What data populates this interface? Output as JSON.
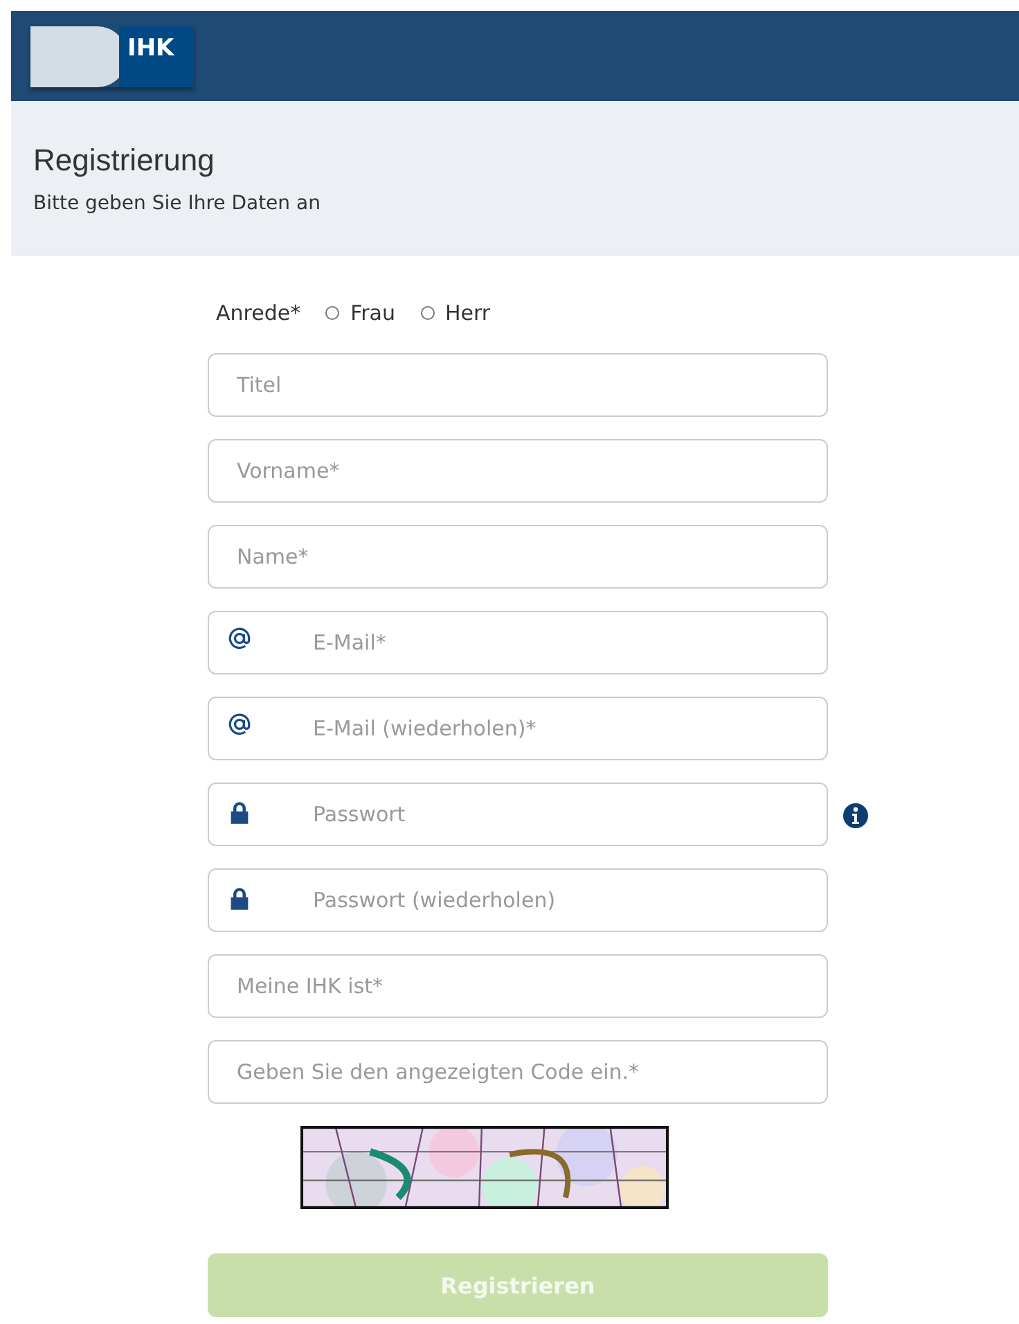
{
  "header": {
    "logo_text": "IHK"
  },
  "intro": {
    "title": "Registrierung",
    "subtitle": "Bitte geben Sie Ihre Daten an"
  },
  "salutation": {
    "label": "Anrede*",
    "options": [
      {
        "label": "Frau",
        "selected": false
      },
      {
        "label": "Herr",
        "selected": false
      }
    ]
  },
  "fields": [
    {
      "kind": "text",
      "placeholder": "Titel"
    },
    {
      "kind": "text",
      "placeholder": "Vorname*"
    },
    {
      "kind": "text",
      "placeholder": "Name*"
    },
    {
      "kind": "email",
      "placeholder": "E-Mail*"
    },
    {
      "kind": "email",
      "placeholder": "E-Mail (wiederholen)*"
    },
    {
      "kind": "password",
      "placeholder": "Passwort",
      "info": true
    },
    {
      "kind": "password",
      "placeholder": "Passwort (wiederholen)"
    },
    {
      "kind": "text",
      "placeholder": "Meine IHK ist*"
    },
    {
      "kind": "text",
      "placeholder": "Geben Sie den angezeigten Code ein.*"
    }
  ],
  "submit": {
    "label": "Registrieren",
    "disabled": true
  }
}
